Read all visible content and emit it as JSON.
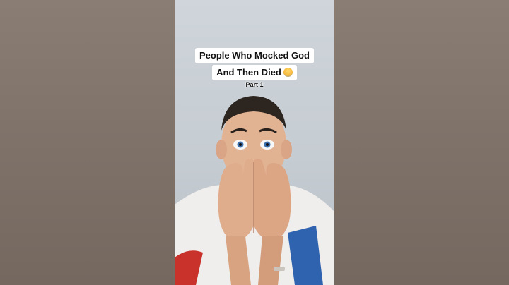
{
  "caption": {
    "line1": "People Who Mocked God",
    "line2": "And Then Died",
    "part": "Part 1"
  },
  "icons": {
    "caption_emoji": "fearful-face-emoji"
  },
  "colors": {
    "side_blur": "#7d7168",
    "wall": "#cfd5da",
    "caption_bg": "#ffffff",
    "caption_text": "#111111"
  }
}
